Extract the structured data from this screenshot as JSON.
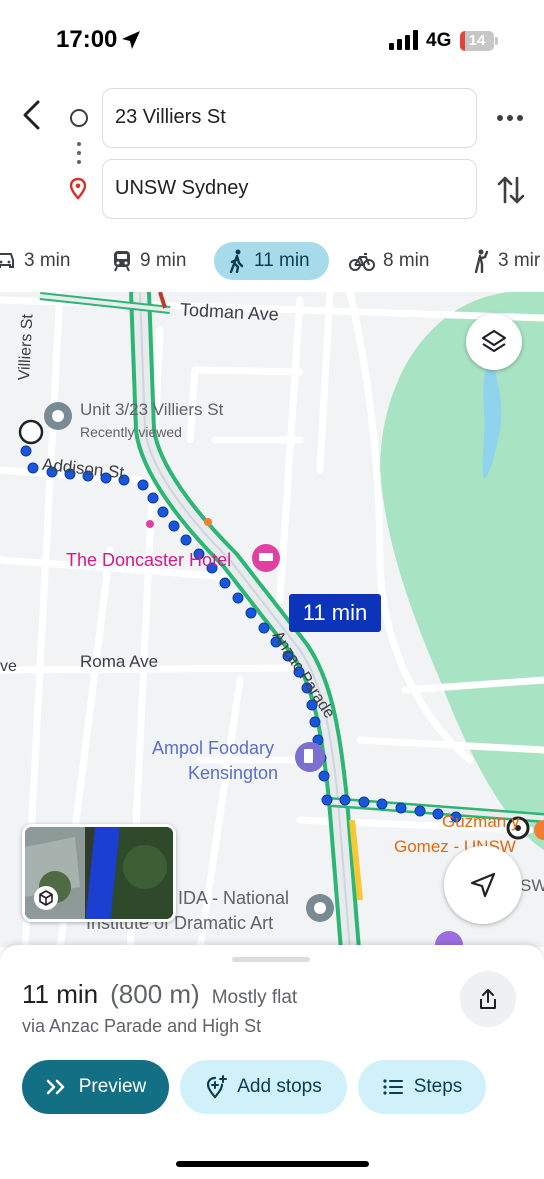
{
  "status_bar": {
    "time": "17:00",
    "network": "4G",
    "battery": "14",
    "battery_level": 0.14
  },
  "header": {
    "origin": "23 Villiers St",
    "destination": "UNSW Sydney"
  },
  "modes": [
    {
      "icon": "car-icon",
      "label": "3 min"
    },
    {
      "icon": "train-icon",
      "label": "9 min"
    },
    {
      "icon": "walk-icon",
      "label": "11 min",
      "active": true
    },
    {
      "icon": "bike-icon",
      "label": "8 min"
    },
    {
      "icon": "ride-icon",
      "label": "3 mir"
    }
  ],
  "map": {
    "streets": {
      "villiers": "Villiers St",
      "todman": "Todman Ave",
      "addison": "Addison St",
      "roma": "Roma Ave",
      "anzac": "Anzac Parade",
      "edge_left": "ve"
    },
    "places": {
      "unit_title": "Unit 3/23 Villiers St",
      "unit_sub": "Recently viewed",
      "hotel": "The Doncaster Hotel",
      "ampol_line1": "Ampol Foodary",
      "ampol_line2": "Kensington",
      "guzman_line1": "Guzman y",
      "guzman_line2": "Gomez - UNSW",
      "nida_line1": "IDA - National",
      "nida_line2": "Institute of Dramatic Art",
      "edge_right": "SW"
    },
    "eta_callout": "11 min",
    "colors": {
      "route": "#1a56db",
      "park": "#a8e3c4",
      "water": "#8fd3ec",
      "road_highlight": "#2bb673"
    }
  },
  "sheet": {
    "duration": "11 min",
    "distance": "(800 m)",
    "terrain": "Mostly flat",
    "via": "via Anzac Parade and High St",
    "buttons": {
      "preview": "Preview",
      "add_stops": "Add stops",
      "steps": "Steps"
    }
  }
}
